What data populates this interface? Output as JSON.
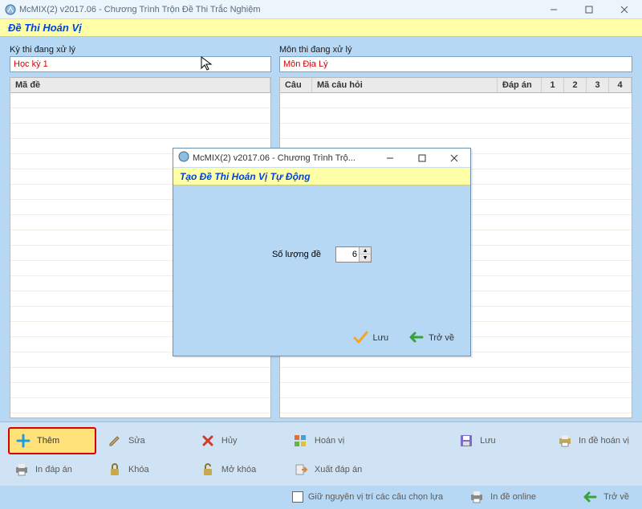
{
  "window": {
    "title": "McMIX(2) v2017.06 - Chương Trình Trộn Đề Thi Trắc Nghiệm",
    "heading": "Đề Thi Hoán Vị"
  },
  "left": {
    "label": "Kỳ thi đang xử lý",
    "value": "Học kỳ 1",
    "grid_header": "Mã đề"
  },
  "right": {
    "label": "Môn thi đang xử lý",
    "value": "Môn Địa Lý",
    "headers": {
      "cau": "Câu",
      "macauhoi": "Mã câu hỏi",
      "dapan": "Đáp án",
      "c1": "1",
      "c2": "2",
      "c3": "3",
      "c4": "4"
    }
  },
  "toolbar": {
    "them": "Thêm",
    "sua": "Sửa",
    "huy": "Hủy",
    "hoanvi": "Hoán vị",
    "luu": "Lưu",
    "indapan": "In đáp án",
    "indehoanvi": "In đề hoán vị",
    "khoa": "Khóa",
    "mokhoa": "Mở khóa",
    "xuatdapan": "Xuất đáp án",
    "giunguyen": "Giữ nguyên vị trí các câu chọn lựa",
    "indeonline": "In đề online",
    "trove": "Trở về"
  },
  "modal": {
    "title": "McMIX(2) v2017.06 - Chương Trình Trộ...",
    "heading": "Tạo Đề Thi Hoán Vị Tự Động",
    "field_label": "Số lượng đề",
    "field_value": "6",
    "save": "Lưu",
    "back": "Trở về"
  }
}
